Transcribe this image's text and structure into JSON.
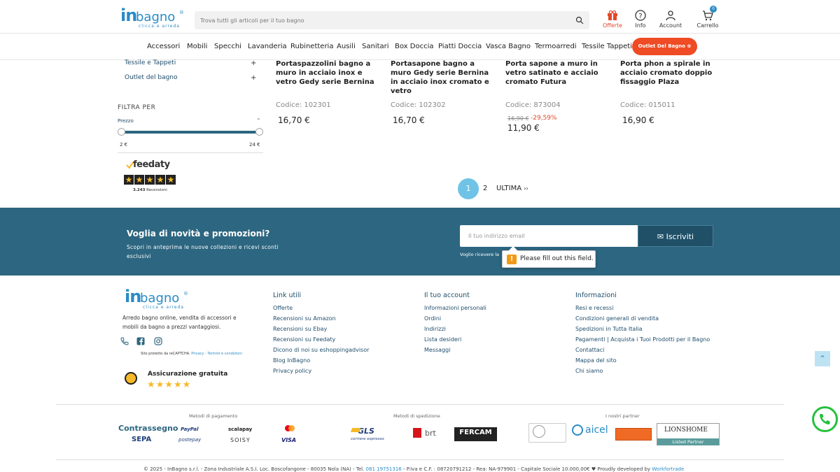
{
  "header": {
    "logo": {
      "in": "in",
      "bagno": "bagno",
      "tagline": "clicca e arreda",
      "trademark": "®"
    },
    "search_placeholder": "Trova tutti gli articoli per il tuo bagno",
    "icons": [
      {
        "label": "Offerte",
        "icon": "gift-icon"
      },
      {
        "label": "Info",
        "icon": "help-icon"
      },
      {
        "label": "Account",
        "icon": "user-icon"
      },
      {
        "label": "Carrello",
        "icon": "cart-icon",
        "badge": "0"
      }
    ]
  },
  "nav": {
    "items": [
      "Accessori",
      "Mobili",
      "Specchi",
      "Lavanderia",
      "Rubinetteria",
      "Ausili",
      "Sanitari",
      "Box Doccia",
      "Piatti Doccia",
      "Vasca Bagno",
      "Termoarredi",
      "Tessile Tappeti"
    ],
    "outlet_button": "Outlet Del Bagno"
  },
  "sidebar": {
    "categories": [
      {
        "label": "Tessile e Tappeti",
        "expand": "+"
      },
      {
        "label": "Outlet del bagno",
        "expand": "+"
      }
    ],
    "filter_title": "FILTRA PER",
    "price_label": "Prezzo",
    "price_min": "2 €",
    "price_max": "24 €",
    "feedaty": {
      "name": "feedaty",
      "count": "3.243",
      "reviews_label": "Recensioni"
    }
  },
  "products": [
    {
      "title": "Portaspazzolini bagno a muro in acciaio inox e vetro Gedy serie Bernina",
      "code": "Codice: 102301",
      "price": "16,70 €"
    },
    {
      "title": "Portasapone bagno a muro Gedy serie Bernina in acciaio inox cromato e vetro",
      "code": "Codice: 102302",
      "price": "16,70 €"
    },
    {
      "title": "Porta sapone a muro in vetro satinato e acciaio cromato Futura",
      "code": "Codice: 873004",
      "old_price": "16,90 €",
      "discount": "-29,59%",
      "price": "11,90 €"
    },
    {
      "title": "Porta phon a spirale in acciaio cromato doppio fissaggio Plaza",
      "code": "Codice: 015011",
      "price": "16,90 €"
    }
  ],
  "pagination": {
    "current": "1",
    "next": "2",
    "last": "ULTIMA",
    "last_icon": "››"
  },
  "newsletter": {
    "title": "Voglia di novità e promozioni?",
    "text": "Scopri in anteprima le nuove collezioni e ricevi sconti esclusivi",
    "email_placeholder": "Il tuo indirizzo email",
    "button": "Iscriviti",
    "consent_text": "Voglio ricevere la",
    "tooltip": "Please fill out this field."
  },
  "footer": {
    "description": "Arredo bagno online, vendita di accessori e mobili da bagno a prezzi vantaggiosi.",
    "recaptcha": {
      "text": "Sito protetto da reCAPTCHA.",
      "privacy": "Privacy",
      "sep": " - ",
      "terms": "Termini e condizioni"
    },
    "insurance_title": "Assicurazione gratuita",
    "insurance_stars": "★★★★★",
    "columns": [
      {
        "title": "Link utili",
        "links": [
          "Offerte",
          "Recensioni su Amazon",
          "Recensioni su Ebay",
          "Recensioni su Feedaty",
          "Dicono di noi su eshoppingadvisor",
          "Blog InBagno",
          "Privacy policy"
        ]
      },
      {
        "title": "Il tuo account",
        "links": [
          "Informazioni personali",
          "Ordini",
          "Indirizzi",
          "Lista desideri",
          "Messaggi"
        ]
      },
      {
        "title": "Informazioni",
        "links": [
          "Resi e recessi",
          "Condizioni generali di vendita",
          "Spedizioni in Tutta Italia",
          "Pagamenti | Acquista i Tuoi Prodotti per il Bagno",
          "Contattaci",
          "Mappa del sito",
          "Chi siamo"
        ]
      }
    ],
    "payments_title": "Metodi di pagamento",
    "shipping_title": "Metodi di spedizione",
    "partners_title": "I nostri partner",
    "payments": [
      "Contrassegno",
      "SEPA",
      "PayPal",
      "postepay",
      "scalapay",
      "SOISY",
      "VISA"
    ],
    "shipping": [
      "GLS",
      "corriere espresso",
      "brt",
      "FERCAM"
    ],
    "partners": [
      "aicel",
      "LIONSHOME",
      "Listed Partner"
    ],
    "copyright": {
      "prefix": "© 2025 - InBagno s.r.l. - Zona Industriale A.S.I. Loc. Boscofangone - 80035 Nola (NA) - Tel. ",
      "phone": "081 19751316",
      "suffix": " - P.Iva e C.F. : 08720791212 - Rea: NA-979901 - Capitale Sociale 10.000,00€ ♥  Proudly developed by ",
      "dev": "Workfortrade"
    }
  },
  "colors": {
    "brand": "#2a8bc6",
    "accent": "#ef4b25",
    "newsletter_bg": "#2d6680",
    "pagination_active": "#6fc3e6"
  }
}
